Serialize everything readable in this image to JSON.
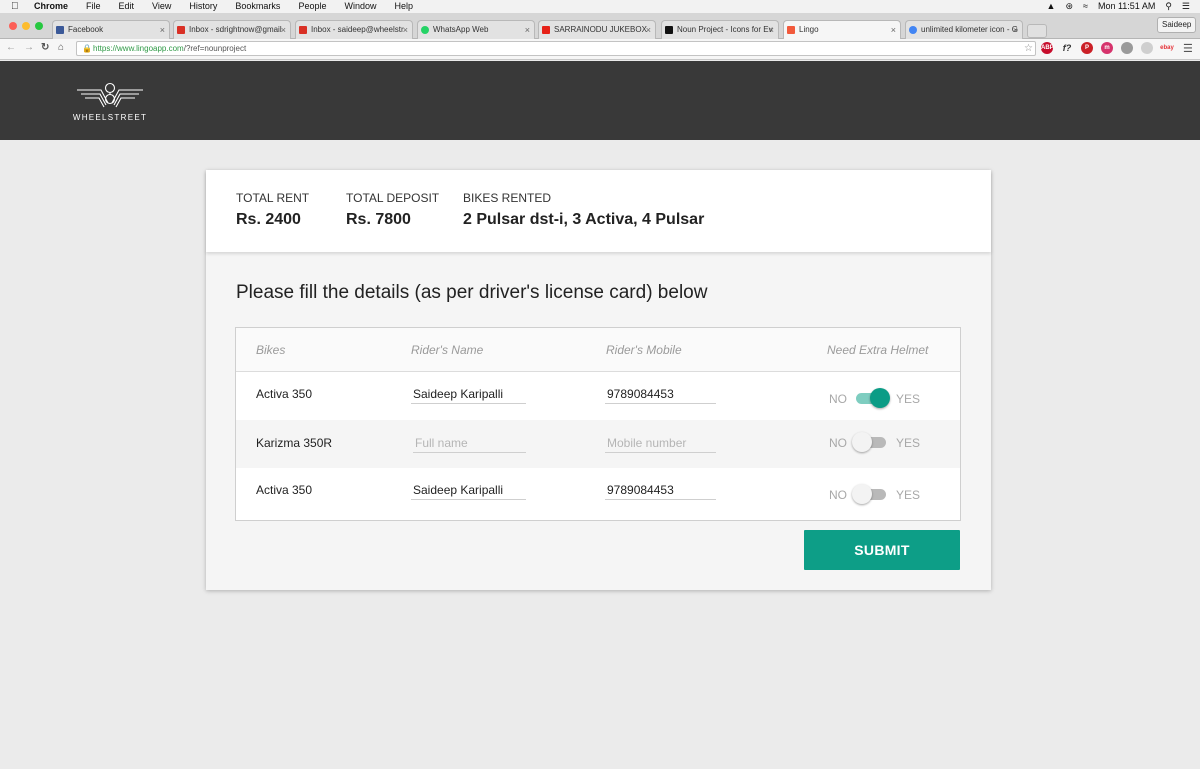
{
  "menubar": {
    "apple_icon": "apple-icon",
    "items": [
      "Chrome",
      "File",
      "Edit",
      "View",
      "History",
      "Bookmarks",
      "People",
      "Window",
      "Help"
    ],
    "clock": "Mon 11:51 AM"
  },
  "tabs": [
    {
      "label": "Facebook",
      "color": "#3b5998"
    },
    {
      "label": "Inbox - sdrightnow@gmail",
      "color": "#d93025"
    },
    {
      "label": "Inbox - saideep@wheelstr",
      "color": "#d93025"
    },
    {
      "label": "WhatsApp Web",
      "color": "#25d366"
    },
    {
      "label": "SARRAINODU JUKEBOX",
      "color": "#e62117"
    },
    {
      "label": "Noun Project - Icons for Ev",
      "color": "#111111"
    },
    {
      "label": "Lingo",
      "color": "#f25a3c"
    },
    {
      "label": "unlimited kilometer icon - G",
      "color": "#4285f4"
    }
  ],
  "profile_name": "Saideep",
  "address_bar": {
    "host": "https://www.lingoapp.com",
    "path": "/?ref=nounproject"
  },
  "extensions": [
    {
      "name": "adblock-icon",
      "label": "ABP",
      "color": "#c70d2c"
    },
    {
      "name": "font-icon",
      "label": "f?",
      "color": "#333333"
    },
    {
      "name": "pinterest-icon",
      "label": "P",
      "color": "#cb2027"
    },
    {
      "name": "mailtrack-icon",
      "label": "m",
      "color": "#d6336c"
    },
    {
      "name": "ghost-icon",
      "label": "",
      "color": "#9a9a9a"
    },
    {
      "name": "ship-icon",
      "label": "",
      "color": "#b0b0b0"
    },
    {
      "name": "ebay-icon",
      "label": "ebay",
      "color": "#e53238"
    }
  ],
  "brand": {
    "name": "WHEELSTREET"
  },
  "summary": {
    "total_rent_label": "TOTAL RENT",
    "total_rent_value": "Rs. 2400",
    "total_deposit_label": "TOTAL DEPOSIT",
    "total_deposit_value": "Rs. 7800",
    "bikes_rented_label": "BIKES RENTED",
    "bikes_rented_value": "2 Pulsar dst-i, 3 Activa, 4 Pulsar"
  },
  "instructions": "Please fill the details (as per driver's license card) below",
  "table": {
    "headers": {
      "bikes": "Bikes",
      "name": "Rider's Name",
      "mobile": "Rider's Mobile",
      "helmet": "Need Extra Helmet"
    },
    "no_label": "NO",
    "yes_label": "YES",
    "name_placeholder": "Full name",
    "mobile_placeholder": "Mobile number",
    "rows": [
      {
        "bike": "Activa 350",
        "name": "Saideep Karipalli",
        "mobile": "9789084453",
        "helmet": true
      },
      {
        "bike": "Karizma 350R",
        "name": "",
        "mobile": "",
        "helmet": false
      },
      {
        "bike": "Activa 350",
        "name": "Saideep Karipalli",
        "mobile": "9789084453",
        "helmet": false
      }
    ]
  },
  "submit_label": "SUBMIT",
  "colors": {
    "accent": "#0d9e87",
    "header_bg": "#393939"
  }
}
